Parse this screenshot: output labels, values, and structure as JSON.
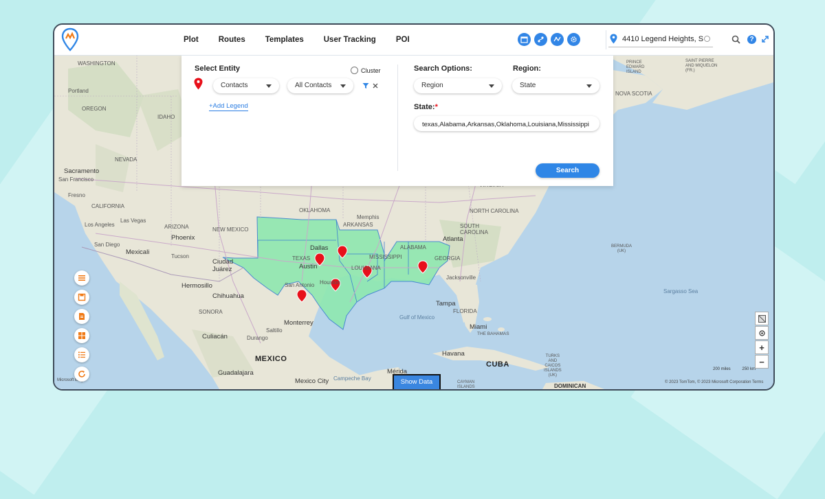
{
  "nav": {
    "menu": [
      "Plot",
      "Routes",
      "Templates",
      "User Tracking",
      "POI"
    ],
    "toolbar_icons": [
      "calendar-icon",
      "route-icon",
      "territory-icon",
      "settings-icon"
    ],
    "address_value": "4410 Legend Heights, Sa ...",
    "icons": {
      "search": "search-icon",
      "help": "help-icon",
      "help_glyph": "?",
      "expand": "expand-icon"
    }
  },
  "panel": {
    "select_entity_label": "Select Entity",
    "cluster_label": "Cluster",
    "entity_select": "Contacts",
    "contacts_filter_select": "All Contacts",
    "add_legend": "+Add Legend",
    "search_options_label": "Search Options:",
    "search_options_value": "Region",
    "region_label": "Region:",
    "region_value": "State",
    "state_label": "State:",
    "state_required": "*",
    "state_value": "texas,Alabama,Arkansas,Oklahoma,Louisiana,Mississippi",
    "search_button": "Search"
  },
  "left_tools": [
    "list-icon",
    "save-icon",
    "document-icon",
    "layout-icon",
    "numbered-list-icon",
    "refresh-icon"
  ],
  "map_controls": {
    "zoom_in": "+",
    "zoom_out": "−",
    "show_data": "Show Data"
  },
  "scale": {
    "miles": "200 miles",
    "km": "250 km"
  },
  "copyright": "© 2023 TomTom, © 2023 Microsoft Corporation  Terms",
  "bing": "Microsoft Bing",
  "colors": {
    "accent": "#2f86e6",
    "region_fill": "#8fe8b0",
    "marker": "#e8101a"
  },
  "map_labels": {
    "washington": "WASHINGTON",
    "oregon": "OREGON",
    "idaho": "IDAHO",
    "portland": "Portland",
    "nevada": "NEVADA",
    "sacramento": "Sacramento",
    "san_francisco": "San Francisco",
    "fresno": "Fresno",
    "california": "CALIFORNIA",
    "los_angeles": "Los Angeles",
    "las_vegas": "Las Vegas",
    "san_diego": "San Diego",
    "mexicali": "Mexicali",
    "phoenix": "Phoenix",
    "tucson": "Tucson",
    "arizona": "ARIZONA",
    "new_mexico": "NEW MEXICO",
    "ciudad_juarez": "Ciudad\nJuárez",
    "chihuahua": "Chihuahua",
    "hermosillo": "Hermosillo",
    "sonora": "SONORA",
    "culiacan": "Culiacán",
    "durango": "Durango",
    "mexico": "MEXICO",
    "guadalajara": "Guadalajara",
    "mexico_city": "Mexico City",
    "monterrey": "Monterrey",
    "saltillo": "Saltillo",
    "oklahoma": "OKLAHOMA",
    "arkansas": "ARKANSAS",
    "texas": "TEXAS",
    "dallas": "Dallas",
    "austin": "Austin",
    "houston": "Houston",
    "san_antonio": "San Antonio",
    "louisiana": "LOUISIANA",
    "mississippi": "MISSISSIPPI",
    "alabama": "ALABAMA",
    "memphis": "Memphis",
    "georgia": "GEORGIA",
    "atlanta": "Atlanta",
    "jacksonville": "Jacksonville",
    "tampa": "Tampa",
    "miami": "Miami",
    "florida": "FLORIDA",
    "virginia": "VIRGINIA",
    "north_carolina": "NORTH CAROLINA",
    "south_carolina": "SOUTH\nCAROLINA",
    "prince_edward": "PRINCE\nEDWARD\nISLAND",
    "saint_pierre": "SAINT PIERRE\nAND MIQUELON\n(FR.)",
    "nova_scotia": "NOVA SCOTIA",
    "bermuda": "BERMUDA\n(UK)",
    "sargasso": "Sargasso Sea",
    "gulf_of_mexico": "Gulf of Mexico",
    "bahamas": "THE BAHAMAS",
    "havana": "Havana",
    "cuba": "CUBA",
    "turks": "TURKS\nAND\nCAICOS\nISLANDS\n(UK)",
    "cayman": "CAYMAN\nISLANDS",
    "dominican": "DOMINICAN",
    "merida": "Mérida",
    "campeche": "Campeche Bay"
  }
}
